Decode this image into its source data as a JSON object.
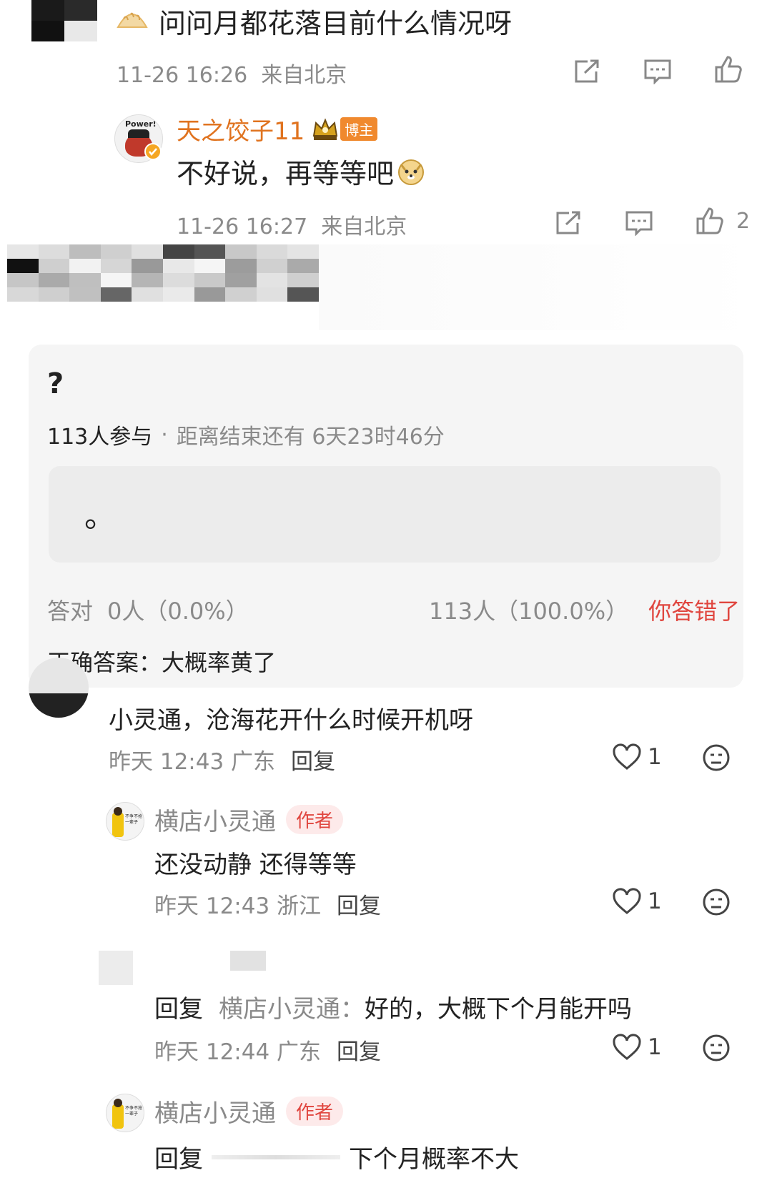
{
  "top_comment": {
    "text": "问问月都花落目前什么情况呀",
    "meta": "11-26 16:26  来自北京"
  },
  "reply_1": {
    "username": "天之饺子11",
    "badge": "博主",
    "avatar_text": "Power!",
    "text": "不好说，再等等吧",
    "meta": "11-26 16:27  来自北京",
    "like_count": "2"
  },
  "poll": {
    "question": "?",
    "participants": "113人参与",
    "sep": "·",
    "remaining": "距离结束还有 6天23时46分",
    "option_text": "。",
    "correct_label": "答对",
    "correct_stats": "0人（0.0%）",
    "wrong_stats": "113人（100.0%）",
    "result": "你答错了",
    "answer": "正确答案：大概率黄了"
  },
  "comments": [
    {
      "text": "小灵通，沧海花开什么时候开机呀",
      "meta": "昨天 12:43 广东",
      "reply_label": "回复",
      "like_count": "1"
    },
    {
      "username": "横店小灵通",
      "author_badge": "作者",
      "avatar_text": "不争不抢 一辈子",
      "text": "还没动静 还得等等",
      "meta": "昨天 12:43 浙江",
      "reply_label": "回复",
      "like_count": "1"
    },
    {
      "reply_prefix": "回复",
      "reply_target": "横店小灵通：",
      "text": "好的，大概下个月能开吗",
      "meta": "昨天 12:44 广东",
      "reply_label": "回复",
      "like_count": "1"
    },
    {
      "username": "横店小灵通",
      "author_badge": "作者",
      "avatar_text": "不争不抢 一辈子",
      "reply_prefix": "回复",
      "text": "下个月概率不大"
    }
  ],
  "colors": {
    "accent_orange": "#e0731f",
    "accent_red": "#e0463f",
    "gold": "#d6a21e",
    "meta_gray": "#8a8a8a"
  }
}
